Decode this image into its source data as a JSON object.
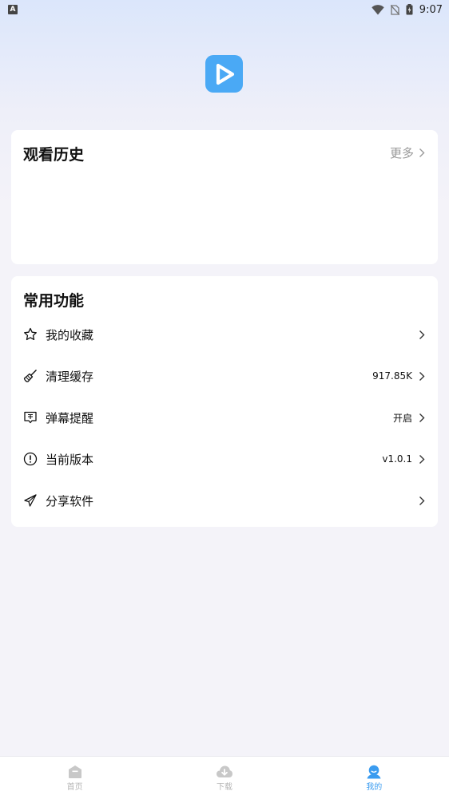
{
  "status_bar": {
    "left_badge": "A",
    "time": "9:07"
  },
  "colors": {
    "accent": "#4aa9f5",
    "nav_active": "#3b9cf0",
    "nav_inactive": "#c8c8c8"
  },
  "history": {
    "title": "观看历史",
    "more_label": "更多"
  },
  "functions": {
    "title": "常用功能",
    "items": [
      {
        "label": "我的收藏",
        "value": "",
        "icon": "star-icon"
      },
      {
        "label": "清理缓存",
        "value": "917.85K",
        "icon": "broom-icon"
      },
      {
        "label": "弹幕提醒",
        "value": "开启",
        "icon": "danmaku-icon"
      },
      {
        "label": "当前版本",
        "value": "v1.0.1",
        "icon": "info-icon"
      },
      {
        "label": "分享软件",
        "value": "",
        "icon": "paper-plane-icon"
      }
    ]
  },
  "bottom_nav": {
    "items": [
      {
        "label": "首页",
        "icon": "home-icon",
        "active": false
      },
      {
        "label": "下载",
        "icon": "download-cloud-icon",
        "active": false
      },
      {
        "label": "我的",
        "icon": "user-icon",
        "active": true
      }
    ]
  }
}
